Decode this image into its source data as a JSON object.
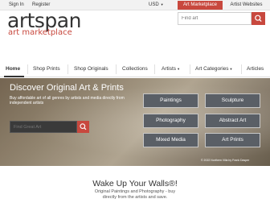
{
  "topbar": {
    "sign_in": "Sign In",
    "register": "Register",
    "currency": "USD",
    "art_marketplace": "Art Marketplace",
    "artist_websites": "Artist Websites"
  },
  "header": {
    "logo": "artspan",
    "logo_sub": "art marketplace",
    "search_placeholder": "Find art"
  },
  "nav": {
    "items": [
      "Home",
      "Shop Prints",
      "Shop Originals",
      "Collections",
      "Artists",
      "Art Categories",
      "Articles"
    ]
  },
  "hero": {
    "title": "Discover Original Art & Prints",
    "subtitle": "Buy affordable art of all genres by artists and media directly from independent artists",
    "search_placeholder": "Find Great Art",
    "categories": [
      "Paintings",
      "Sculpture",
      "Photography",
      "Abstract Art",
      "Mixed Media",
      "Art Prints"
    ],
    "credit": "© 2022 Northern Villa by Frank Dasper"
  },
  "promo": {
    "tagline": "Wake Up Your Walls®!",
    "subtitle": "Original Paintings and Photography - buy directly from the artists and save."
  },
  "colors": {
    "accent": "#c8483e",
    "category_button": "#5a5f66"
  }
}
